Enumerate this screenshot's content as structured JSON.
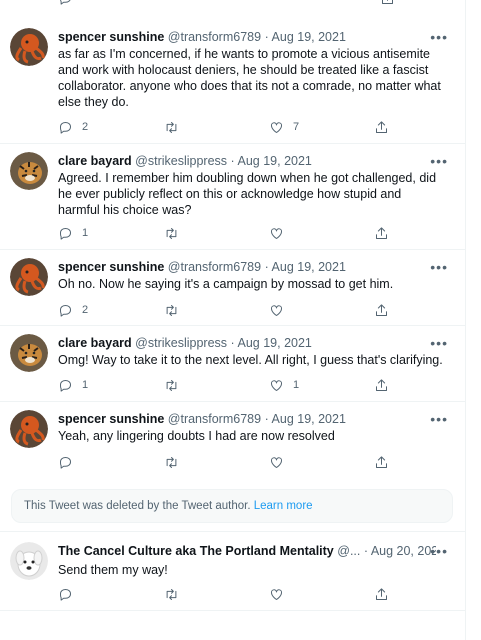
{
  "tweets": [
    {
      "name": "spencer sunshine",
      "handle": "@transform6789",
      "date": "Aug 19, 2021",
      "text": "as far as I'm concerned, if he wants to promote a vicious antisemite and work with holocaust deniers, he should be treated like a fascist collaborator. anyone who does that its not a comrade, no matter what else they do.",
      "replies": "2",
      "retweets": "",
      "likes": "7",
      "avatar": "octopus"
    },
    {
      "name": "clare bayard",
      "handle": "@strikeslippress",
      "date": "Aug 19, 2021",
      "text": "Agreed. I remember him doubling down when he got challenged, did he ever publicly reflect on this or acknowledge how stupid and harmful his choice was?",
      "replies": "1",
      "retweets": "",
      "likes": "",
      "avatar": "tiger"
    },
    {
      "name": "spencer sunshine",
      "handle": "@transform6789",
      "date": "Aug 19, 2021",
      "text": "Oh no. Now he saying it's a campaign by mossad to get him.",
      "replies": "2",
      "retweets": "",
      "likes": "",
      "avatar": "octopus"
    },
    {
      "name": "clare bayard",
      "handle": "@strikeslippress",
      "date": "Aug 19, 2021",
      "text": "Omg! Way to take it to the next level. All right, I guess that's clarifying.",
      "replies": "1",
      "retweets": "",
      "likes": "1",
      "avatar": "tiger"
    },
    {
      "name": "spencer sunshine",
      "handle": "@transform6789",
      "date": "Aug 19, 2021",
      "text": "Yeah, any lingering doubts I had are now resolved",
      "replies": "",
      "retweets": "",
      "likes": "",
      "avatar": "octopus"
    },
    {
      "name": "The Cancel Culture aka The Portland Mentality",
      "handle": "@...",
      "date": "Aug 20, 2021",
      "text": "Send them my way!",
      "replies": "",
      "retweets": "",
      "likes": "",
      "avatar": "dog"
    }
  ],
  "deleted_notice": {
    "text": "This Tweet was deleted by the Tweet author.",
    "link": "Learn more"
  },
  "separator": "·",
  "colors": {
    "accent": "#1d9bf0",
    "muted": "#536471",
    "text": "#0f1419",
    "border": "#eff3f4"
  },
  "icons": [
    "reply-icon",
    "retweet-icon",
    "like-icon",
    "share-icon",
    "more-icon"
  ]
}
